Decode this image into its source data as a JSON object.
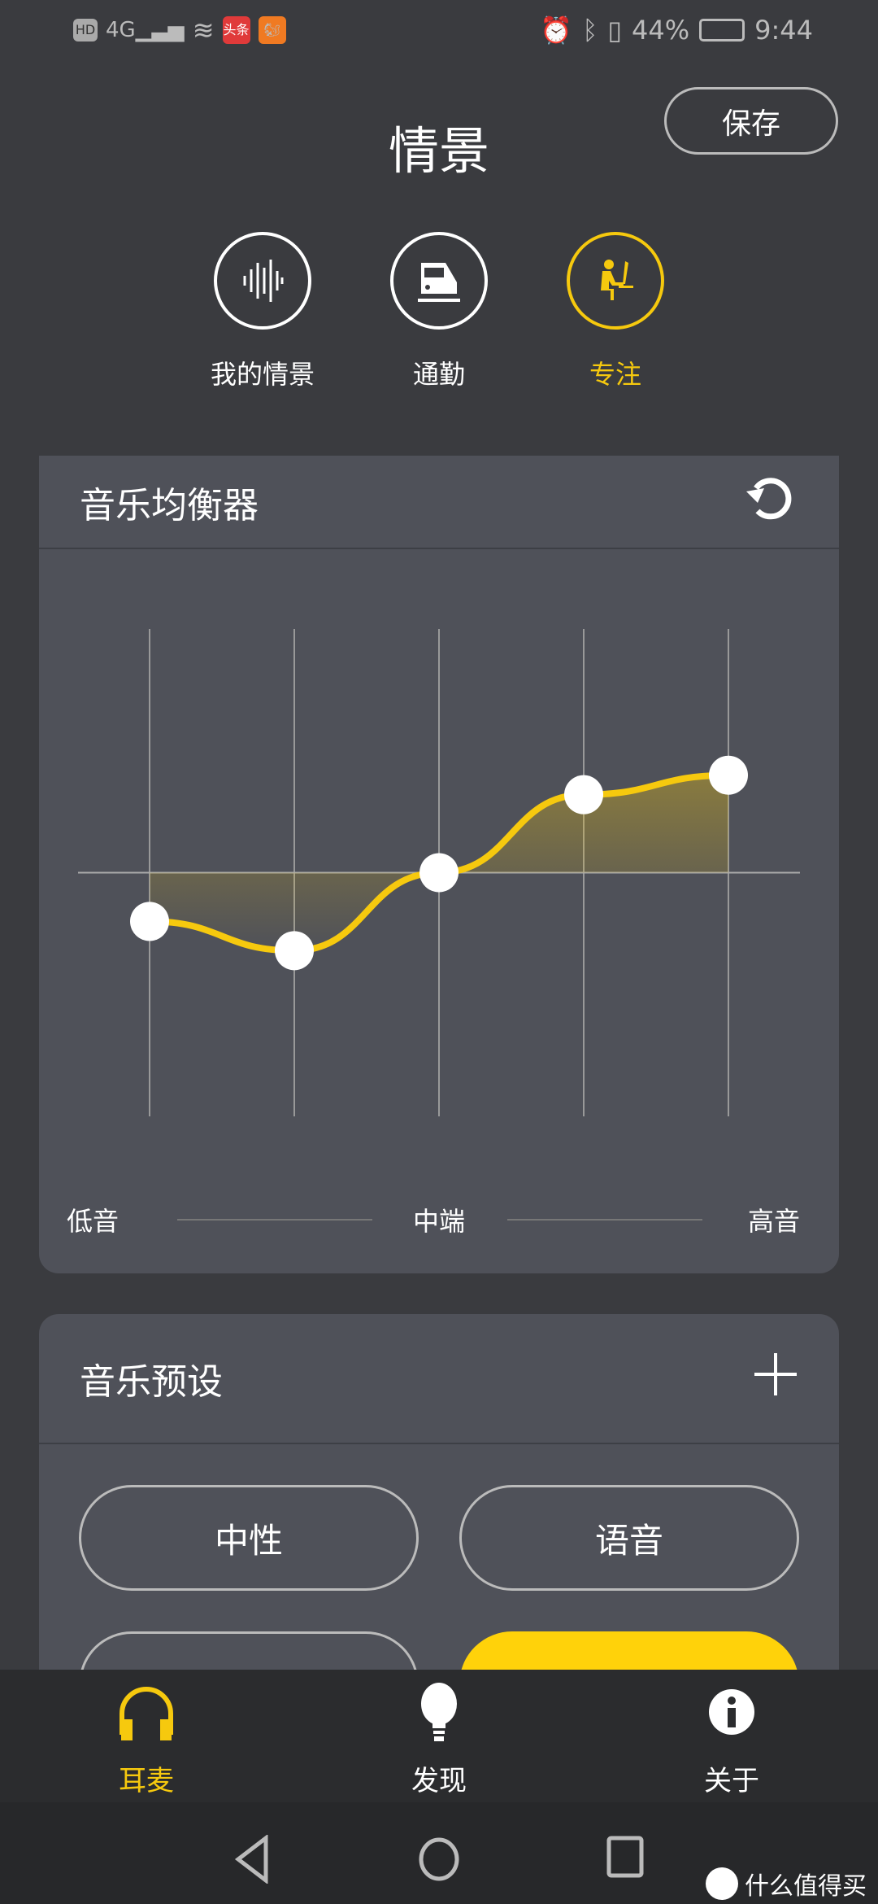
{
  "status_bar": {
    "left_icons": [
      "hd-icon",
      "4g-signal-icon",
      "wifi-icon",
      "toutiao-app-icon",
      "uc-browser-app-icon"
    ],
    "toutiao_label": "头条",
    "battery_percent": "44%",
    "time": "9:44",
    "right_icons": [
      "alarm-icon",
      "bluetooth-icon",
      "vibrate-icon",
      "battery-icon"
    ]
  },
  "header": {
    "title": "情景",
    "save_label": "保存"
  },
  "scenes": [
    {
      "label": "我的情景",
      "icon": "soundwave-icon",
      "active": false
    },
    {
      "label": "通勤",
      "icon": "train-icon",
      "active": false
    },
    {
      "label": "专注",
      "icon": "person-at-desk-icon",
      "active": true
    }
  ],
  "equalizer": {
    "title": "音乐均衡器",
    "reset_icon": "reset-icon",
    "labels": {
      "low": "低音",
      "mid": "中端",
      "high": "高音"
    }
  },
  "chart_data": {
    "type": "line",
    "bands": 5,
    "levels": [
      -0.2,
      -0.32,
      0,
      0.32,
      0.4
    ],
    "level_range": [
      -1,
      1
    ],
    "curve_color": "#f6c90e",
    "x_labels": [
      "低音",
      "中端",
      "高音"
    ]
  },
  "presets": {
    "title": "音乐预设",
    "add_icon": "plus-icon",
    "items": [
      {
        "label": "中性",
        "selected": false
      },
      {
        "label": "语音",
        "selected": false
      },
      {
        "label": "",
        "selected": false
      },
      {
        "label": "",
        "selected": true
      }
    ]
  },
  "bottom_nav": [
    {
      "label": "耳麦",
      "icon": "headphones-icon",
      "active": true
    },
    {
      "label": "发现",
      "icon": "lightbulb-icon",
      "active": false
    },
    {
      "label": "关于",
      "icon": "info-icon",
      "active": false
    }
  ],
  "watermark": "什么值得买",
  "colors": {
    "accent": "#f6c90e",
    "background": "#3a3b3f",
    "card": "#4f5159"
  }
}
